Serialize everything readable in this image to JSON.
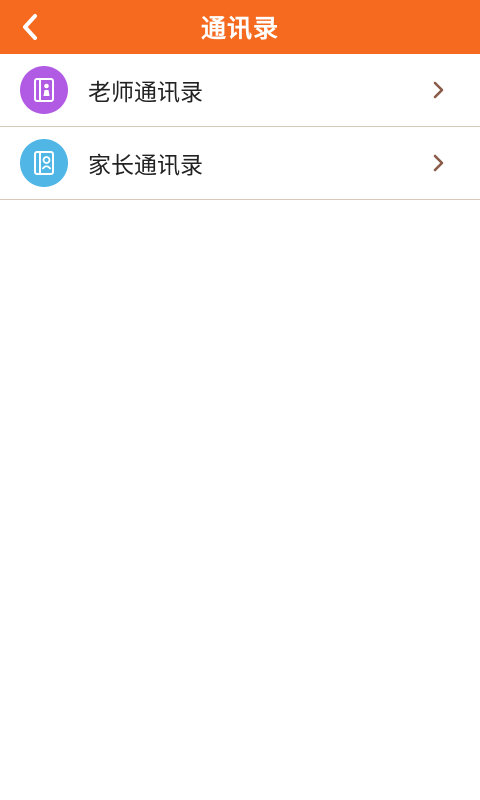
{
  "header": {
    "title": "通讯录",
    "background_color": "#f56a1f",
    "back_icon": "chevron-left-icon"
  },
  "contacts": {
    "items": [
      {
        "label": "老师通讯录",
        "icon": "teacher-contacts-icon",
        "icon_color": "#b15be4",
        "chevron_icon": "chevron-right-icon"
      },
      {
        "label": "家长通讯录",
        "icon": "parent-contacts-icon",
        "icon_color": "#4fb6e6",
        "chevron_icon": "chevron-right-icon"
      }
    ]
  }
}
